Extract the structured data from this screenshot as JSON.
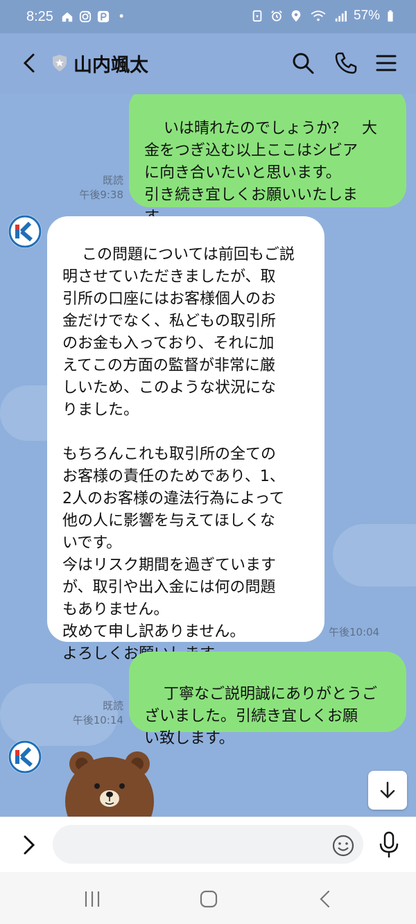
{
  "status_bar": {
    "time": "8:25",
    "dot": "•",
    "battery": "57%",
    "left_icons": [
      "home-icon",
      "instagram-icon",
      "paypay-icon"
    ],
    "right_icons": [
      "recycle-icon",
      "alarm-icon",
      "location-icon",
      "wifi-icon",
      "signal-icon",
      "battery-icon"
    ]
  },
  "header": {
    "title": "山内颯太",
    "icons": [
      "back-icon",
      "shield-icon",
      "search-icon",
      "phone-icon",
      "menu-icon"
    ]
  },
  "messages": [
    {
      "direction": "out",
      "text": "いは晴れたのでしょうか？　大\n金をつぎ込む以上ここはシビア\nに向き合いたいと思います。\n引き続き宜しくお願いいたしま\nす。",
      "read": "既読",
      "time": "午後9:38"
    },
    {
      "direction": "in",
      "text": "この問題については前回もご説\n明させていただきましたが、取\n引所の口座にはお客様個人のお\n金だけでなく、私どもの取引所\nのお金も入っており、それに加\nえてこの方面の監督が非常に厳\nしいため、このような状況にな\nりました。\n\nもちろんこれも取引所の全ての\nお客様の責任のためであり、1、\n2人のお客様の違法行為によって\n他の人に影響を与えてほしくな\nいです。\n今はリスク期間を過ぎています\nが、取引や出入金には何の問題\nもありません。\n改めて申し訳ありません。\nよろしくお願いします。",
      "time": "午後10:04"
    },
    {
      "direction": "out",
      "text": "丁寧なご説明誠にありがとうご\nざいました。引続き宜しくお願\nい致します。",
      "read": "既読",
      "time": "午後10:14"
    },
    {
      "direction": "in",
      "sticker": "bear-sticker"
    }
  ],
  "input": {
    "placeholder": "",
    "icons": [
      "expand-icon",
      "emoji-icon",
      "microphone-icon",
      "scroll-down-icon"
    ]
  },
  "colors": {
    "outgoing_bubble": "#8be27c",
    "incoming_bubble": "#ffffff",
    "chat_background": "#8fb0dc"
  }
}
